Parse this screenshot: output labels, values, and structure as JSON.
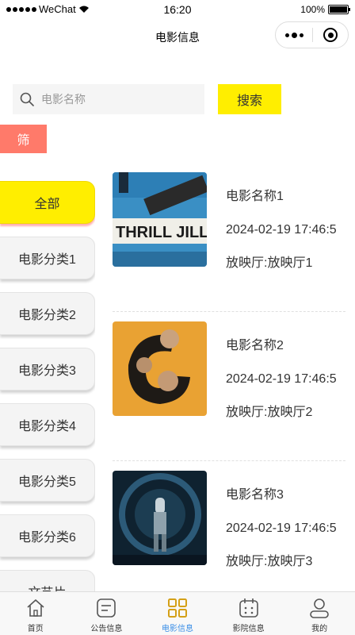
{
  "status_bar": {
    "carrier": "WeChat",
    "time": "16:20",
    "battery": "100%",
    "battery_level": 1.0
  },
  "nav": {
    "title": "电影信息"
  },
  "search": {
    "placeholder": "电影名称",
    "button": "搜索"
  },
  "filter": {
    "label": "筛"
  },
  "categories": [
    {
      "label": "全部",
      "active": true
    },
    {
      "label": "电影分类1"
    },
    {
      "label": "电影分类2"
    },
    {
      "label": "电影分类3"
    },
    {
      "label": "电影分类4"
    },
    {
      "label": "电影分类5"
    },
    {
      "label": "电影分类6"
    },
    {
      "label": "文艺片"
    }
  ],
  "movies": [
    {
      "name": "电影名称1",
      "time": "2024-02-19 17:46:5",
      "hall": "放映厅:放映厅1",
      "poster_text": "THRILL JILL"
    },
    {
      "name": "电影名称2",
      "time": "2024-02-19 17:46:5",
      "hall": "放映厅:放映厅2"
    },
    {
      "name": "电影名称3",
      "time": "2024-02-19 17:46:5",
      "hall": "放映厅:放映厅3"
    }
  ],
  "tabs": [
    {
      "label": "首页",
      "icon": "home-icon"
    },
    {
      "label": "公告信息",
      "icon": "notice-icon"
    },
    {
      "label": "电影信息",
      "icon": "grid-icon",
      "active": true
    },
    {
      "label": "影院信息",
      "icon": "calendar-icon"
    },
    {
      "label": "我的",
      "icon": "user-icon"
    }
  ],
  "colors": {
    "accent_yellow": "#ffee00",
    "filter_red": "#ff7a6a",
    "tab_active_blue": "#3a8ee6"
  }
}
